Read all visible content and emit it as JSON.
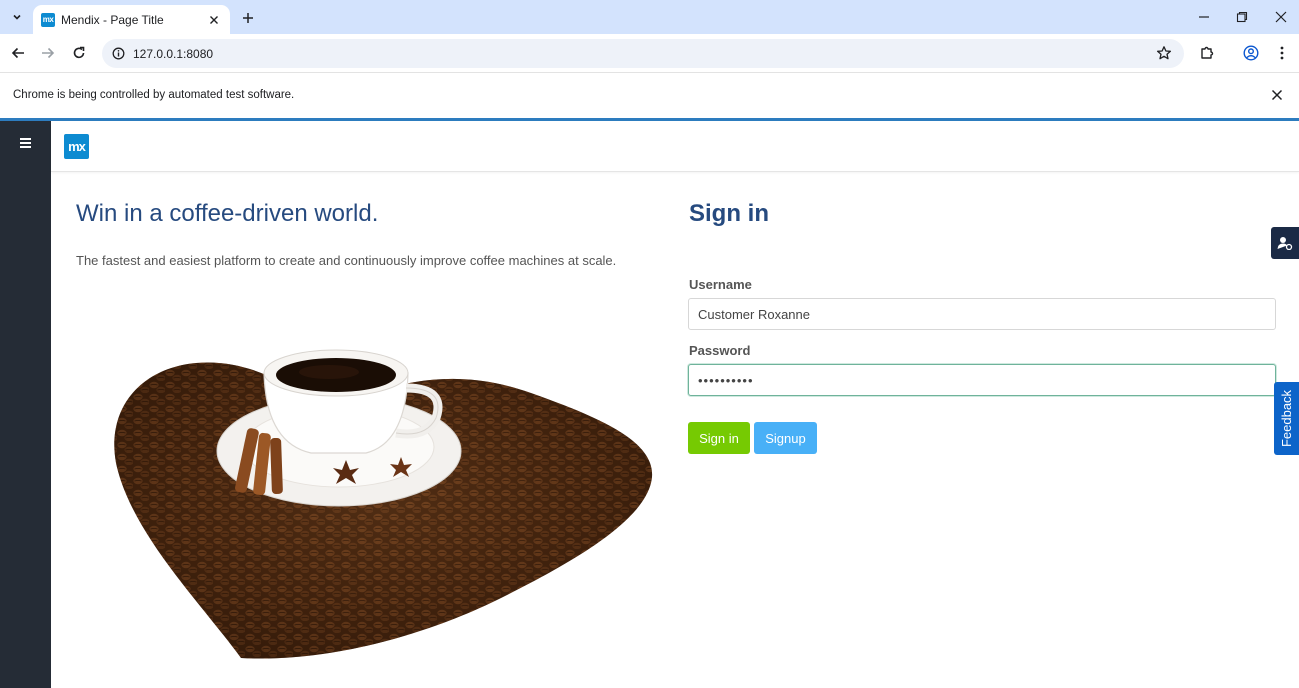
{
  "browser": {
    "tab_title": "Mendix - Page Title",
    "favicon_text": "mx",
    "url": "127.0.0.1:8080",
    "infobar_text": "Chrome is being controlled by automated test software."
  },
  "app": {
    "logo_text": "mx",
    "hero_title": "Win in a coffee-driven world.",
    "hero_subtitle": "The fastest and easiest platform to create and continuously improve coffee machines at scale.",
    "signin": {
      "title": "Sign in",
      "username_label": "Username",
      "username_value": "Customer Roxanne",
      "password_label": "Password",
      "password_value": "••••••••••",
      "signin_button": "Sign in",
      "signup_button": "Signup"
    },
    "feedback_label": "Feedback"
  },
  "colors": {
    "accent_blue": "#264a7f",
    "mendix_blue": "#0d8bd1",
    "signin_green": "#76ca02",
    "signup_blue": "#48b0f7",
    "sidebar": "#252c36",
    "feedback": "#0d64c9"
  },
  "icons": [
    "tab-search-icon",
    "close-icon",
    "plus-icon",
    "minimize-icon",
    "restore-icon",
    "back-arrow-icon",
    "forward-arrow-icon",
    "reload-icon",
    "info-icon",
    "star-icon",
    "extensions-icon",
    "profile-icon",
    "kebab-menu-icon",
    "hamburger-icon",
    "user-settings-icon"
  ]
}
